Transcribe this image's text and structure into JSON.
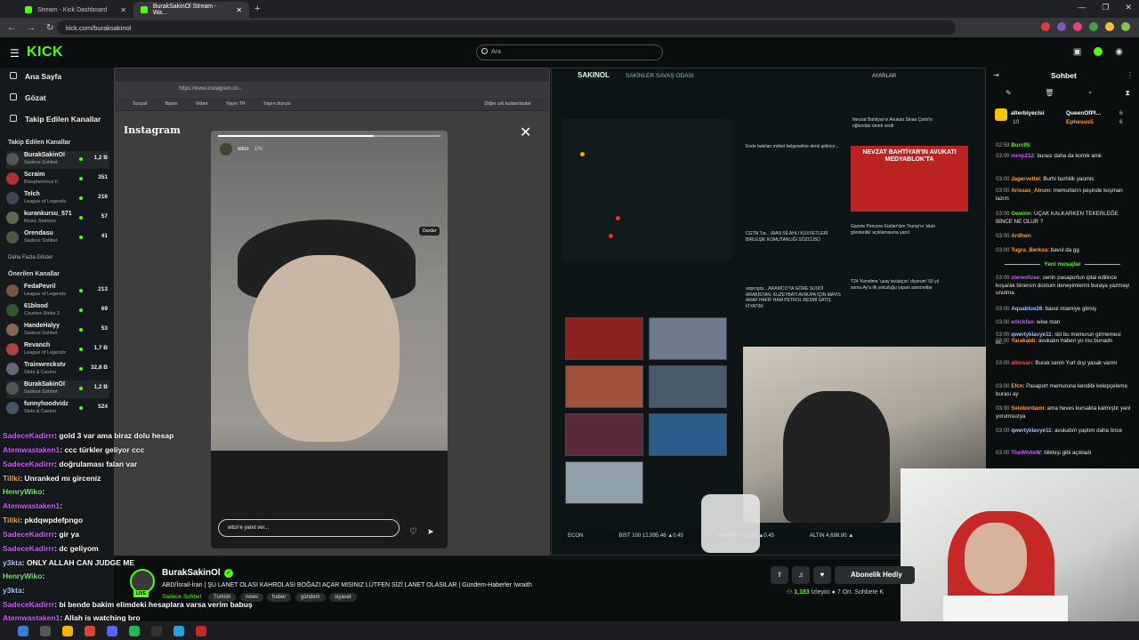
{
  "browser": {
    "tabs": [
      {
        "label": "Stream - Kick Dashboard"
      },
      {
        "label": "BurakSakinOl Stream - Wa..."
      }
    ],
    "url": "kick.com/buraksakinol"
  },
  "header": {
    "logo": "KICK",
    "search_placeholder": "Ara"
  },
  "sidebar": {
    "nav": [
      {
        "label": "Ana Sayfa"
      },
      {
        "label": "Gözat"
      },
      {
        "label": "Takip Edilen Kanallar"
      }
    ],
    "followed_title": "Takip Edilen Kanallar",
    "followed": [
      {
        "name": "BurakSakinOl",
        "category": "Sadece Sohbet",
        "viewers": "1,2 B"
      },
      {
        "name": "Scraim",
        "category": "Blasphemous II",
        "viewers": "351"
      },
      {
        "name": "Telch",
        "category": "League of Legends",
        "viewers": "216"
      },
      {
        "name": "kurankursu_571",
        "category": "Music Stations",
        "viewers": "57"
      },
      {
        "name": "Orendasu",
        "category": "Sadece Sohbet",
        "viewers": "41"
      }
    ],
    "show_more": "Daha Fazla Göster",
    "recommended_title": "Önerilen Kanallar",
    "recommended": [
      {
        "name": "FedaPevril",
        "category": "League of Legends",
        "viewers": "213"
      },
      {
        "name": "61blood",
        "category": "Counter-Strike 2",
        "viewers": "69"
      },
      {
        "name": "HandeHalyy",
        "category": "Sadece Sohbet",
        "viewers": "53"
      },
      {
        "name": "Revanch",
        "category": "League of Legends",
        "viewers": "1,7 B"
      },
      {
        "name": "Trainwreckstv",
        "category": "Slots & Casino",
        "viewers": "32,8 B"
      },
      {
        "name": "BurakSakinOl",
        "category": "Sadece Sohbet",
        "viewers": "1,2 B"
      },
      {
        "name": "funnyhoodvidz",
        "category": "Slots & Casino",
        "viewers": "524"
      }
    ]
  },
  "stream_content": {
    "insta_logo": "Instagram",
    "bookmarks": [
      "Sosyal",
      "Basın",
      "Video",
      "Yayın TR",
      "Yayın dünya",
      "Diğer sık kullanılanlar"
    ],
    "insta_url": "https://www.instagram.co...",
    "story_user": "wtcn",
    "story_time": "10s",
    "pause_tip": "Durdur",
    "reply_placeholder": "wtcn'e yanıt ver...",
    "war_title": "SAKINOL",
    "war_sub": "SAKİNLER SAVAŞ ODASI",
    "war_settings": "AYARLAR",
    "headline": "NEVZAT BAHTİYAR'IN AVUKATI MEDYABLOK'TA",
    "news": [
      "Nevzat Bahtiyar'ın Avukatı Sinan Çetin'in oğlundan ömek verdi",
      "Ende bakılan mirket belgeseline denk gelince...",
      "CGTN Tur... IRAN SİLAHLI KUVVETLERİ BİRLEŞİK KOMUTANLIĞI SÖZCÜSÜ",
      "Gazete Pencere Kürtler'den Trump'ın 'silah gönderdik' açıklamasına yanıt",
      "T24 'Kendime 'uzay teslatçısı' diyorum' 50 yıl sonra Ay'a ilk yolculuğu yapan astronotlar",
      "unprogra... ARAMCO'YA GÖRE SUUDİ ARABİSTAN, KUZEYBATI AVRUPA İÇİN MAYIS ARAP HAFİF HAM PETROL RESMİ SATIŞ FİYATINI"
    ],
    "ticker": [
      "ECON",
      "BIST 100 12,995.46 ▲0.45",
      "EUR/TRY 51.60 ▲0.45",
      "ALTIN 4,698.90 ▲"
    ]
  },
  "overlay_chat": [
    {
      "user": "SadeceKadirrr",
      "text": ": gold 3 var ama biraz dolu hesap",
      "color": "purple"
    },
    {
      "user": "Atemwastaken1",
      "text": ": ccc türkler geliyor ccc",
      "color": "purple"
    },
    {
      "user": "SadeceKadirrr",
      "text": ": doğrulaması falan var",
      "color": "purple"
    },
    {
      "user": "Tillki",
      "text": ": Unranked mı girceniz",
      "color": "orange"
    },
    {
      "user": "HenryWiko",
      "text": ":",
      "color": "green"
    },
    {
      "user": "Atemwastaken1",
      "text": ":",
      "color": "purple"
    },
    {
      "user": "Tillki",
      "text": ": pkdqwpdefpngo",
      "color": "orange"
    },
    {
      "user": "SadeceKadirrr",
      "text": ": gir ya",
      "color": "purple"
    },
    {
      "user": "SadeceKadirrr",
      "text": ": dc geliyom",
      "color": "purple"
    },
    {
      "user": "y3kta",
      "text": ": ONLY ALLAH CAN JUDGE ME",
      "color": "blue"
    },
    {
      "user": "HenryWiko",
      "text": ":",
      "color": "green"
    },
    {
      "user": "y3kta",
      "text": ":",
      "color": "blue"
    },
    {
      "user": "SadeceKadirrr",
      "text": ": bi bende bakim elimdeki hesaplara varsa verim babuş",
      "color": "purple"
    },
    {
      "user": "Atemwastaken1",
      "text": ": Allah is watching bro",
      "color": "purple"
    }
  ],
  "stream_info": {
    "name": "BurakSakinOl",
    "live": "LIVE",
    "title": "ABD/İsrail-İran | ŞU LANET OLASI KAHROLASI BOĞAZI AÇAR MISINIZ LÜTFEN SİZİ LANET OLASILAR | Gündem-Haberler !wraith",
    "category": "Sadece Sohbet",
    "tags": [
      "Turkish",
      "news",
      "haber",
      "gündem",
      "siyaset"
    ],
    "subscribe": "Abonelik Hediy",
    "viewers": "1,183",
    "viewers_label": "İzleyici",
    "chatters": "7 Ort. Sohbete K"
  },
  "chat": {
    "title": "Sohbet",
    "pinned": [
      {
        "user": "alterbiyeclsi",
        "count": "10"
      },
      {
        "user": "QueenOfPl...",
        "count": "6"
      },
      {
        "user": "Ephesus5",
        "count": "6"
      }
    ],
    "messages": [
      {
        "time": "02:59",
        "user": "Burc95",
        "text": ":",
        "color": "#53fc18"
      },
      {
        "time": "03:00",
        "user": "mrnp212",
        "text": ": burası daha da komik amk",
        "color": "#d25cff"
      },
      {
        "time": "03:00",
        "user": "Jagervettel",
        "text": ": Burhi burhilik yaomis",
        "color": "#ff9e3b"
      },
      {
        "time": "03:00",
        "user": "Arissax_Atrum",
        "text": ": memurların peşinde koşman lazım",
        "color": "#ff9e3b"
      },
      {
        "time": "03:00",
        "user": "Gweinn",
        "text": ": UÇAK KALKARKEN TEKERLEĞE BİNCE NE OLUR ?",
        "color": "#53fc18"
      },
      {
        "time": "03:00",
        "user": "Ardhon",
        "text": ":",
        "color": "#ff9e3b"
      },
      {
        "time": "03:00",
        "user": "Tugra_Berksu",
        "text": ": bavul da gg",
        "color": "#ff9e3b"
      }
    ],
    "new_label": "Yeni mesajlar",
    "new_messages": [
      {
        "time": "03:00",
        "user": "stereolizee",
        "text": ": senin pasaportun iptal edilince koşarak binersin dostum deneyimlerini buraya yazmayı unutma",
        "color": "#d25cff"
      },
      {
        "time": "03:00",
        "user": "Aquablue26",
        "text": ": bavul miamiye gitmiş",
        "color": "#9fc2ff"
      },
      {
        "time": "03:00",
        "user": "erlickfan",
        "text": ": wise man",
        "color": "#d25cff"
      },
      {
        "time": "03:00",
        "user": "qwertyklavye11",
        "text": ": sbl bu memurun girmemesi ol...",
        "color": "#9fc2ff"
      },
      {
        "time": "03:00",
        "user": "Yarakaldı",
        "text": ": avukatın haberi yo mu bunadn",
        "color": "#ff9e3b"
      },
      {
        "time": "03:00",
        "user": "altınsarı",
        "text": ": Burak senin Yurt dışı yasak varmı",
        "color": "#ff4d4d"
      },
      {
        "time": "03:00",
        "user": "Efcn",
        "text": ": Pasaport memuruna kendibi kelepçeleme burası ay",
        "color": "#ff9e3b"
      },
      {
        "time": "03:00",
        "user": "Selobıırdamı",
        "text": ": ama heves kursakta kalmıştır yani yorumsuzya",
        "color": "#ff9e3b"
      },
      {
        "time": "03:00",
        "user": "qwertyklavye11",
        "text": ": avukatım yaptım daha önce",
        "color": "#9fc2ff"
      },
      {
        "time": "03:00",
        "user": "TheWhiteW",
        "text": ": bilirkişi gibi açıkladı",
        "color": "#d25cff"
      }
    ]
  },
  "colors": {
    "accent": "#53fc18",
    "background": "#0b0e0f",
    "sidebar": "#16191b"
  }
}
